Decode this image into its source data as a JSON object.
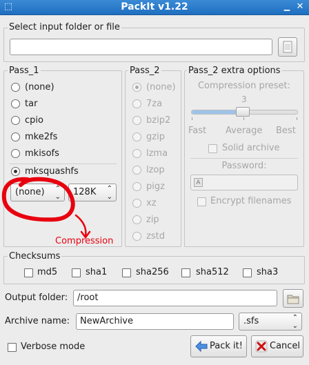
{
  "window": {
    "title": "PackIt v1.22"
  },
  "input": {
    "section_label": "Select input folder or file",
    "value": ""
  },
  "pass1": {
    "label": "Pass_1",
    "options": [
      "(none)",
      "tar",
      "cpio",
      "mke2fs",
      "mkisofs",
      "mksquashfs"
    ],
    "selected": "mksquashfs",
    "compression_combo": "(none)",
    "block_size_combo": "128K",
    "annotation": "Compression",
    "annotation_color": "#e8000f"
  },
  "pass2": {
    "label": "Pass_2",
    "options": [
      "(none)",
      "7za",
      "bzip2",
      "gzip",
      "lzma",
      "lzop",
      "pigz",
      "xz",
      "zip",
      "zstd"
    ],
    "selected": "(none)"
  },
  "extra": {
    "label": "Pass_2 extra options",
    "compression_preset_label": "Compression preset:",
    "preset_value": "3",
    "slider_fast": "Fast",
    "slider_average": "Average",
    "slider_best": "Best",
    "solid_archive": "Solid archive",
    "password_label": "Password:",
    "encrypt_filenames": "Encrypt filenames"
  },
  "checksums": {
    "label": "Checksums",
    "items": [
      "md5",
      "sha1",
      "sha256",
      "sha512",
      "sha3"
    ]
  },
  "output": {
    "label": "Output folder:",
    "value": "/root"
  },
  "archive": {
    "label": "Archive name:",
    "value": "NewArchive",
    "extension": ".sfs"
  },
  "verbose": {
    "label": "Verbose mode"
  },
  "actions": {
    "pack": "Pack it!",
    "cancel": "Cancel"
  },
  "colors": {
    "titlebar": "#1f6fc0",
    "annotation": "#e8000f"
  }
}
